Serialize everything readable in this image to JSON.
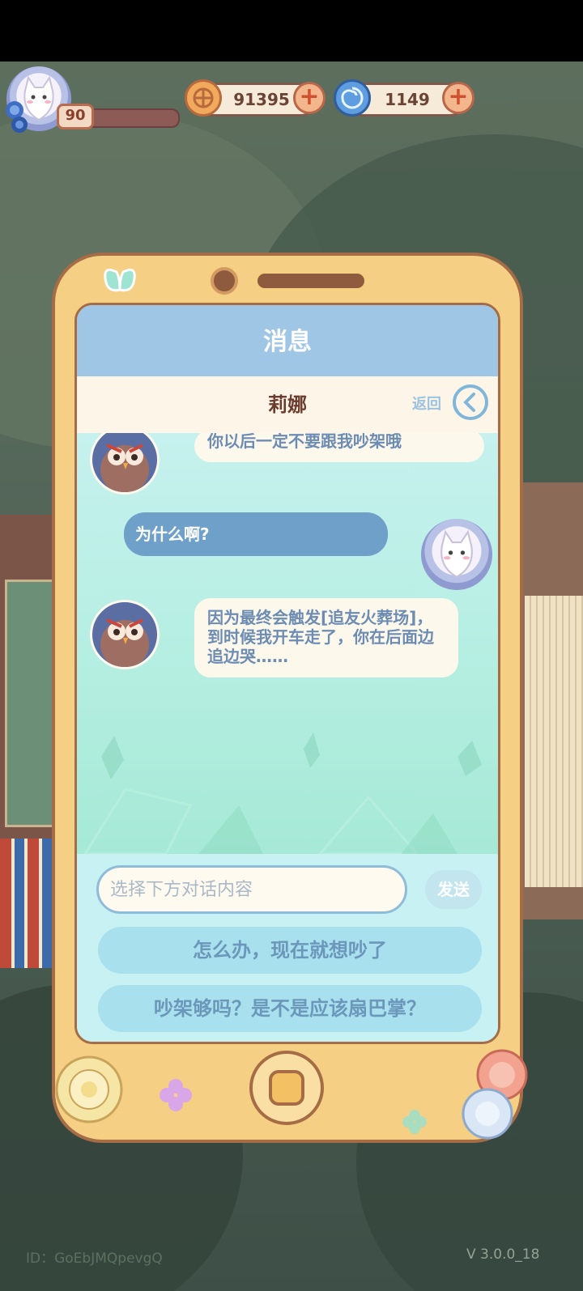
{
  "hud": {
    "level": "90",
    "coins": "91395",
    "gems": "1149"
  },
  "phone": {
    "title": "消息",
    "contact_name": "莉娜",
    "back_label": "返回"
  },
  "messages": [
    {
      "side": "left",
      "text": "你以后一定不要跟我吵架哦"
    },
    {
      "side": "right",
      "text": "为什么啊?"
    },
    {
      "side": "left",
      "text": "因为最终会触发[追友火葬场]，到时候我开车走了，你在后面边追边哭……"
    }
  ],
  "input": {
    "placeholder": "选择下方对话内容",
    "send_label": "发送"
  },
  "options": [
    "怎么办，现在就想吵了",
    "吵架够吗？是不是应该扇巴掌？"
  ],
  "footer": {
    "id": "ID：GoEbJMQpevgQ",
    "version": "V 3.0.0_18"
  },
  "colors": {
    "phone_body": "#f4cf84",
    "title_bar": "#9fc6e4",
    "my_bubble": "#6fa0c9",
    "their_bubble": "#fcf8ec"
  }
}
